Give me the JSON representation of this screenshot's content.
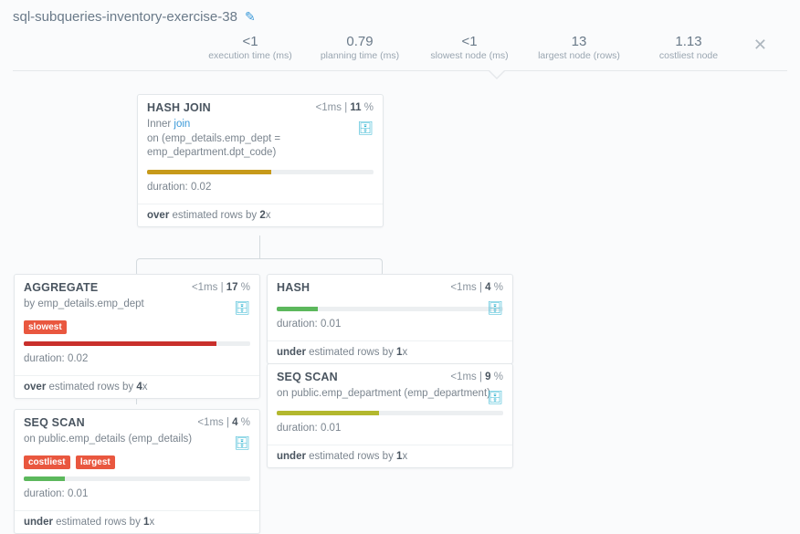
{
  "title": "sql-subqueries-inventory-exercise-38",
  "metrics": [
    {
      "value": "<1",
      "label": "execution time (ms)"
    },
    {
      "value": "0.79",
      "label": "planning time (ms)"
    },
    {
      "value": "<1",
      "label": "slowest node (ms)"
    },
    {
      "value": "13",
      "label": "largest node (rows)"
    },
    {
      "value": "1.13",
      "label": "costliest node"
    }
  ],
  "nodes": {
    "hashjoin": {
      "title": "HASH JOIN",
      "time": "<1ms",
      "pctPrefix": "11",
      "pctSuffix": " %",
      "line1a": "Inner ",
      "line1b": "join",
      "line2a": "on ",
      "line2b": "(emp_details.emp_dept = emp_department.dpt_code)",
      "barColor": "#c79a1a",
      "barPct": 55,
      "durLabel": "duration: ",
      "durVal": "0.02",
      "estA": "over",
      "estB": " estimated rows by ",
      "estC": "2",
      "estD": "x"
    },
    "aggregate": {
      "title": "AGGREGATE",
      "time": "<1ms",
      "pctPrefix": "17",
      "pctSuffix": " %",
      "line1a": "by ",
      "line1b": "emp_details.emp_dept",
      "tag1": "slowest",
      "barColor": "#c9302c",
      "barPct": 85,
      "durLabel": "duration: ",
      "durVal": "0.02",
      "estA": "over",
      "estB": " estimated rows by ",
      "estC": "4",
      "estD": "x"
    },
    "seqscan1": {
      "title": "SEQ SCAN",
      "time": "<1ms",
      "pctPrefix": "4",
      "pctSuffix": " %",
      "line1a": "on ",
      "line1b": "public.emp_details (emp_details)",
      "tag1": "costliest",
      "tag2": "largest",
      "barColor": "#5cb85c",
      "barPct": 18,
      "durLabel": "duration: ",
      "durVal": "0.01",
      "estA": "under",
      "estB": " estimated rows by ",
      "estC": "1",
      "estD": "x"
    },
    "hash": {
      "title": "HASH",
      "time": "<1ms",
      "pctPrefix": "4",
      "pctSuffix": " %",
      "barColor": "#5cb85c",
      "barPct": 18,
      "durLabel": "duration: ",
      "durVal": "0.01",
      "estA": "under",
      "estB": " estimated rows by ",
      "estC": "1",
      "estD": "x"
    },
    "seqscan2": {
      "title": "SEQ SCAN",
      "time": "<1ms",
      "pctPrefix": "9",
      "pctSuffix": " %",
      "line1a": "on ",
      "line1b": "public.emp_department (emp_department)",
      "barColor": "#b3b82e",
      "barPct": 45,
      "durLabel": "duration: ",
      "durVal": "0.01",
      "estA": "under",
      "estB": " estimated rows by ",
      "estC": "1",
      "estD": "x"
    }
  }
}
